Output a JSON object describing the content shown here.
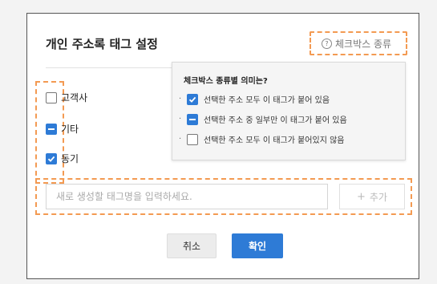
{
  "dialog": {
    "title": "개인 주소록 태그 설정",
    "help_label": "체크박스 종류"
  },
  "tags": [
    {
      "label": "고객사",
      "state": "unchecked"
    },
    {
      "label": "기타",
      "state": "partial"
    },
    {
      "label": "동기",
      "state": "checked"
    }
  ],
  "tooltip": {
    "title": "체크박스 종류별 의미는?",
    "items": [
      {
        "state": "checked",
        "text": "선택한 주소 모두 이 태그가 붙어 있음"
      },
      {
        "state": "partial",
        "text": "선택한 주소 중 일부만 이 태그가 붙어 있음"
      },
      {
        "state": "unchecked",
        "text": "선택한 주소 모두 이 태그가 붙어있지 않음"
      }
    ]
  },
  "new_tag": {
    "placeholder": "새로 생성할 태그명을 입력하세요.",
    "value": "",
    "add_label": "추가",
    "add_icon": "plus-icon"
  },
  "buttons": {
    "cancel": "취소",
    "ok": "확인"
  },
  "colors": {
    "accent": "#2e7bd6",
    "highlight": "#f39a52"
  },
  "icons": {
    "help": "question-circle-icon",
    "checked": "checkmark-icon",
    "partial": "dash-icon"
  }
}
